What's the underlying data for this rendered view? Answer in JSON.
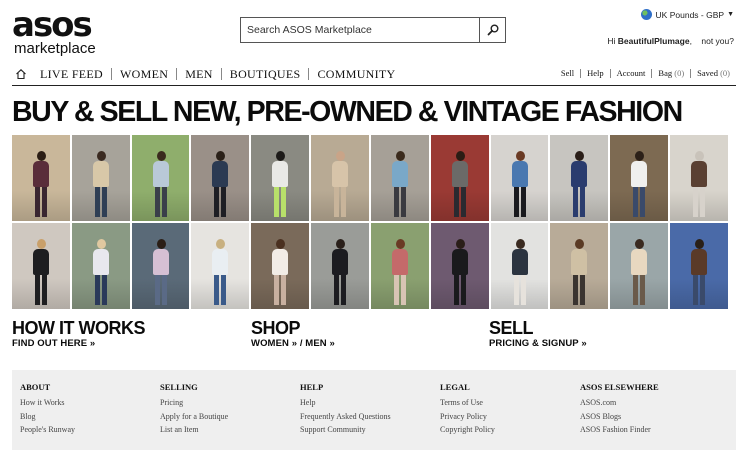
{
  "header": {
    "logo_main": "asos",
    "logo_sub": "marketplace",
    "search_placeholder": "Search ASOS Marketplace",
    "currency": "UK Pounds - GBP",
    "greeting_prefix": "Hi ",
    "username": "BeautifulPlumage",
    "not_you": "not you?"
  },
  "nav": {
    "items": [
      "LIVE FEED",
      "WOMEN",
      "MEN",
      "BOUTIQUES",
      "COMMUNITY"
    ],
    "right": [
      {
        "label": "Sell",
        "count": ""
      },
      {
        "label": "Help",
        "count": ""
      },
      {
        "label": "Account",
        "count": ""
      },
      {
        "label": "Bag",
        "count": "(0)"
      },
      {
        "label": "Saved",
        "count": "(0)"
      }
    ]
  },
  "headline": "BUY & SELL NEW, PRE-OWNED & VINTAGE FASHION",
  "sections": [
    {
      "title": "HOW IT WORKS",
      "link": "FIND OUT HERE »"
    },
    {
      "title": "SHOP",
      "link": "WOMEN » / MEN »"
    },
    {
      "title": "SELL",
      "link": "PRICING & SIGNUP »"
    }
  ],
  "footer": [
    {
      "heading": "ABOUT",
      "links": [
        "How it Works",
        "Blog",
        "People's Runway"
      ]
    },
    {
      "heading": "SELLING",
      "links": [
        "Pricing",
        "Apply for a Boutique",
        "List an Item"
      ]
    },
    {
      "heading": "HELP",
      "links": [
        "Help",
        "Frequently Asked Questions",
        "Support Community"
      ]
    },
    {
      "heading": "LEGAL",
      "links": [
        "Terms of Use",
        "Privacy Policy",
        "Copyright Policy"
      ]
    },
    {
      "heading": "ASOS ELSEWHERE",
      "links": [
        "ASOS.com",
        "ASOS Blogs",
        "ASOS Fashion Finder"
      ]
    }
  ],
  "photos": [
    {
      "bg": "#c9b79a",
      "head": "#2b1d14",
      "body": "#5a2d3a",
      "legs": "#3a2630"
    },
    {
      "bg": "#a7a39a",
      "head": "#3a2a20",
      "body": "#d8c8a8",
      "legs": "#2f3f55"
    },
    {
      "bg": "#8fae6c",
      "head": "#3a2a1e",
      "body": "#b9c9d8",
      "legs": "#3a3f4a"
    },
    {
      "bg": "#9a9088",
      "head": "#2a2018",
      "body": "#2b3a52",
      "legs": "#1e1e24"
    },
    {
      "bg": "#8a8a82",
      "head": "#1c1a18",
      "body": "#e9e9e6",
      "legs": "#b8e06a"
    },
    {
      "bg": "#b8aa94",
      "head": "#c9a488",
      "body": "#d7c4a9",
      "legs": "#c8b49a"
    },
    {
      "bg": "#a6a097",
      "head": "#3a2a1c",
      "body": "#7aa8c8",
      "legs": "#3a3a40"
    },
    {
      "bg": "#9a3a34",
      "head": "#2a1c14",
      "body": "#6b6a68",
      "legs": "#2a2a30"
    },
    {
      "bg": "#d6d3cf",
      "head": "#6a3a24",
      "body": "#4a78b0",
      "legs": "#1a1a1e"
    },
    {
      "bg": "#c7c5c0",
      "head": "#2a1e18",
      "body": "#2a3c6e",
      "legs": "#2a3c6e"
    },
    {
      "bg": "#7d6a52",
      "head": "#2c2018",
      "body": "#f0f0ee",
      "legs": "#3a4a6a"
    },
    {
      "bg": "#d8d4cc",
      "head": "#c9c3ba",
      "body": "#5a4032",
      "legs": "#d7d2cb"
    },
    {
      "bg": "#cfc8c0",
      "head": "#c9a06a",
      "body": "#1e1e20",
      "legs": "#1e1e20"
    },
    {
      "bg": "#8a9a84",
      "head": "#e0c8a0",
      "body": "#e8e8ee",
      "legs": "#2a3a5a"
    },
    {
      "bg": "#5a6a78",
      "head": "#2a1e16",
      "body": "#d6c0d4",
      "legs": "#5a6a86"
    },
    {
      "bg": "#e6e4e0",
      "head": "#c8b080",
      "body": "#e9eef2",
      "legs": "#3a5a8a"
    },
    {
      "bg": "#7a6a5a",
      "head": "#4a3020",
      "body": "#f2ece6",
      "legs": "#c8b0a0"
    },
    {
      "bg": "#9a9c98",
      "head": "#2a201a",
      "body": "#1c1c20",
      "legs": "#1c1c20"
    },
    {
      "bg": "#8aa070",
      "head": "#6a3a24",
      "body": "#c46a6a",
      "legs": "#d8c4b4"
    },
    {
      "bg": "#6e5a70",
      "head": "#2a1e18",
      "body": "#1a1a1c",
      "legs": "#1a1a1c"
    },
    {
      "bg": "#e2e2e0",
      "head": "#3a2a20",
      "body": "#2c3440",
      "legs": "#e6e2dc"
    },
    {
      "bg": "#b8ab98",
      "head": "#5a3a24",
      "body": "#cfc0a4",
      "legs": "#3a3430"
    },
    {
      "bg": "#9aa6a8",
      "head": "#3a2a20",
      "body": "#e8d8c0",
      "legs": "#6a5a4a"
    },
    {
      "bg": "#4a6aa8",
      "head": "#2a2018",
      "body": "#5a3a28",
      "legs": "#3a4a6a"
    }
  ]
}
